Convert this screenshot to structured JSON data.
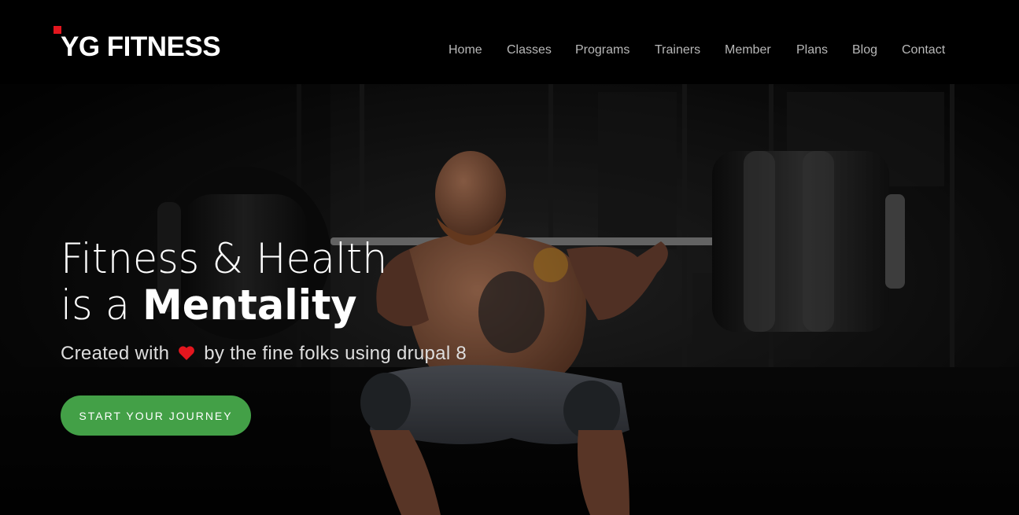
{
  "brand": {
    "name": "YG FITNESS",
    "accent_color": "#e3161e"
  },
  "nav": {
    "items": [
      {
        "label": "Home"
      },
      {
        "label": "Classes"
      },
      {
        "label": "Programs"
      },
      {
        "label": "Trainers"
      },
      {
        "label": "Member"
      },
      {
        "label": "Plans"
      },
      {
        "label": "Blog"
      },
      {
        "label": "Contact"
      }
    ]
  },
  "hero": {
    "headline_line1": "Fitness & Health",
    "headline_line2_prefix": "is a ",
    "headline_line2_bold": "Mentality",
    "tagline_before": "Created with",
    "tagline_icon": "heart-icon",
    "tagline_after": "by the fine folks using drupal 8",
    "cta_label": "START YOUR JOURNEY",
    "cta_color": "#43a047",
    "background_image": "weightlifter-squat-barbell-photo"
  }
}
